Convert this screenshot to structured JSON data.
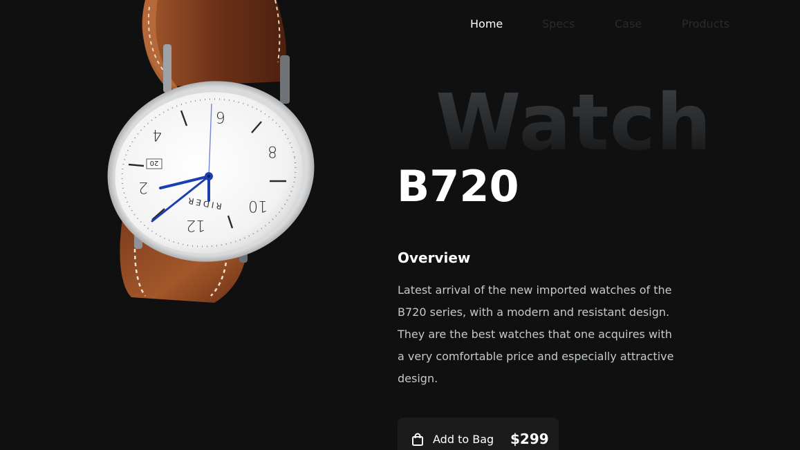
{
  "nav": {
    "items": [
      {
        "label": "Home",
        "active": true
      },
      {
        "label": "Specs",
        "active": false
      },
      {
        "label": "Case",
        "active": false
      },
      {
        "label": "Products",
        "active": false
      }
    ]
  },
  "hero": {
    "background_word": "Watch",
    "model": "B720",
    "overview_title": "Overview",
    "overview_text": "Latest arrival of the new imported watches of the B720 series, with a modern and resistant design. They are the best watches that one acquires with a very comfortable price and especially attractive design.",
    "image": {
      "brand": "RIDER",
      "date": "20",
      "dial_numbers": [
        "2",
        "4",
        "6",
        "8",
        "10",
        "12"
      ]
    }
  },
  "cart": {
    "icon": "shopping-bag-icon",
    "label": "Add to Bag",
    "price": "$299"
  },
  "colors": {
    "background": "#101010",
    "text": "#ffffff",
    "muted_text": "#c4c9cd",
    "inactive_nav": "#2a2a2a",
    "button_bg": "#1b1b1b",
    "strap": "#7a3b1d",
    "hands": "#1c3fb0"
  }
}
